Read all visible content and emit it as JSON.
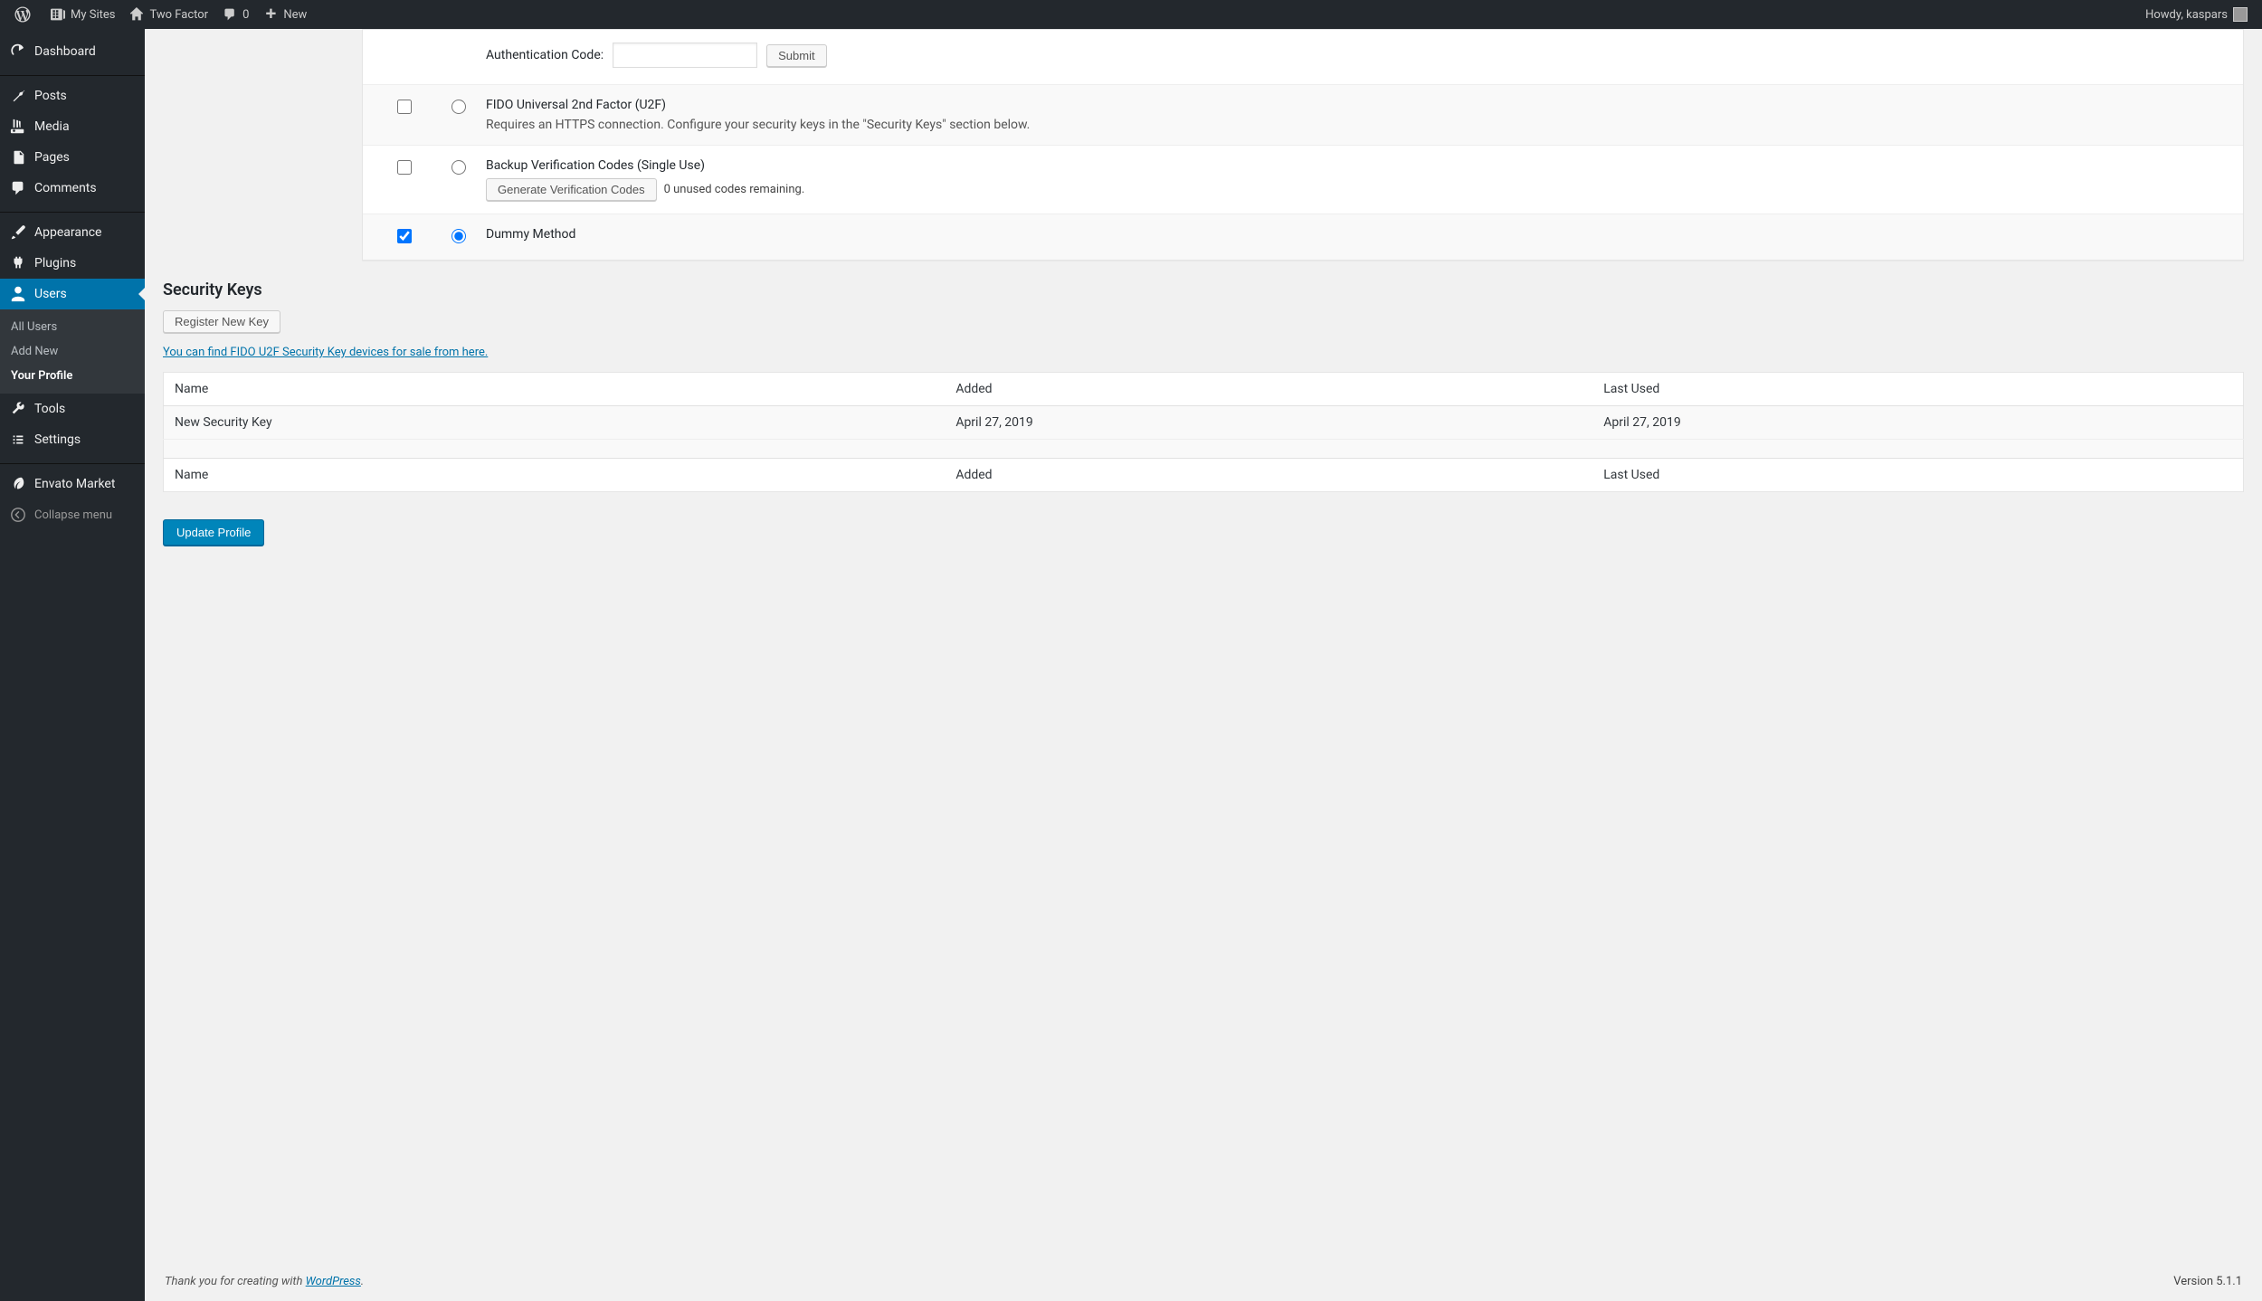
{
  "adminBar": {
    "mySites": "My Sites",
    "siteName": "Two Factor",
    "commentCount": "0",
    "newLabel": "New",
    "howdy": "Howdy, kaspars"
  },
  "sidebar": {
    "dashboard": "Dashboard",
    "posts": "Posts",
    "media": "Media",
    "pages": "Pages",
    "comments": "Comments",
    "appearance": "Appearance",
    "plugins": "Plugins",
    "users": "Users",
    "tools": "Tools",
    "settings": "Settings",
    "envato": "Envato Market",
    "collapse": "Collapse menu",
    "submenu": {
      "allUsers": "All Users",
      "addNew": "Add New",
      "yourProfile": "Your Profile"
    }
  },
  "twoFactor": {
    "authCodeLabel": "Authentication Code:",
    "submit": "Submit",
    "fido": {
      "title": "FIDO Universal 2nd Factor (U2F)",
      "desc": "Requires an HTTPS connection. Configure your security keys in the \"Security Keys\" section below."
    },
    "backup": {
      "title": "Backup Verification Codes (Single Use)",
      "generateBtn": "Generate Verification Codes",
      "status": "0 unused codes remaining."
    },
    "dummy": {
      "title": "Dummy Method"
    }
  },
  "securityKeys": {
    "heading": "Security Keys",
    "registerBtn": "Register New Key",
    "findLink": "You can find FIDO U2F Security Key devices for sale from here.",
    "headers": {
      "name": "Name",
      "added": "Added",
      "lastUsed": "Last Used"
    },
    "rows": [
      {
        "name": "New Security Key",
        "added": "April 27, 2019",
        "lastUsed": "April 27, 2019"
      }
    ]
  },
  "updateBtn": "Update Profile",
  "footer": {
    "thank": "Thank you for creating with ",
    "wp": "WordPress",
    "period": ".",
    "version": "Version 5.1.1"
  }
}
